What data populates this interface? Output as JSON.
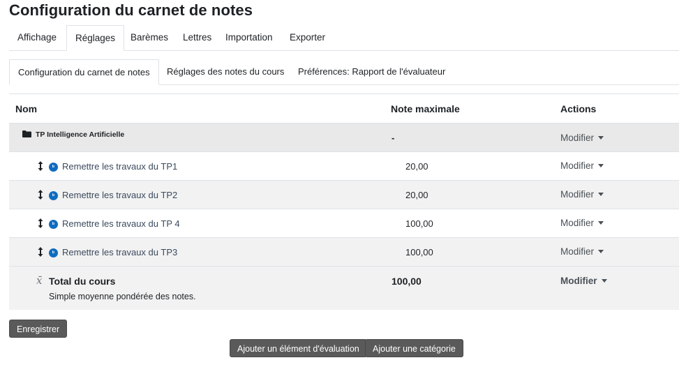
{
  "page": {
    "title": "Configuration du carnet de notes"
  },
  "tabs": [
    {
      "label": "Affichage"
    },
    {
      "label": "Réglages"
    },
    {
      "label": "Barèmes"
    },
    {
      "label": "Lettres"
    },
    {
      "label": "Importation"
    },
    {
      "label": "Exporter"
    }
  ],
  "subtabs": [
    {
      "label": "Configuration du carnet de notes"
    },
    {
      "label": "Réglages des notes du cours"
    },
    {
      "label": "Préférences: Rapport de l'évaluateur"
    }
  ],
  "table": {
    "headers": {
      "name": "Nom",
      "max": "Note maximale",
      "actions": "Actions"
    },
    "category": {
      "name": "TP Intelligence Artificielle",
      "max": "-",
      "action": "Modifier"
    },
    "items": [
      {
        "name": "Remettre les travaux du TP1",
        "max": "20,00",
        "action": "Modifier"
      },
      {
        "name": "Remettre les travaux du TP2",
        "max": "20,00",
        "action": "Modifier"
      },
      {
        "name": "Remettre les travaux du TP 4",
        "max": "100,00",
        "action": "Modifier"
      },
      {
        "name": "Remettre les travaux du TP3",
        "max": "100,00",
        "action": "Modifier"
      }
    ],
    "total": {
      "symbol": "x̄",
      "name": "Total du cours",
      "description": "Simple moyenne pondérée des notes.",
      "max": "100,00",
      "action": "Modifier"
    }
  },
  "buttons": {
    "save": "Enregistrer",
    "add_item": "Ajouter un élément d'évaluation",
    "add_category": "Ajouter une catégorie"
  }
}
